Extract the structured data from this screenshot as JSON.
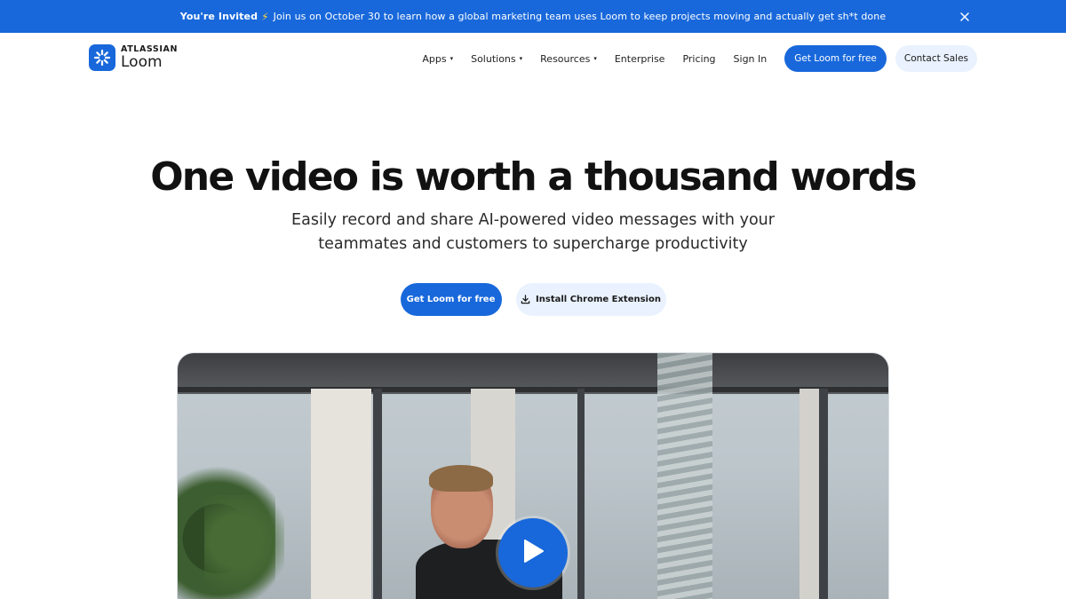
{
  "banner": {
    "lead": "You're Invited",
    "bolt": "⚡",
    "message": "Join us on October 30 to learn how a global marketing team uses Loom to keep projects moving and actually get sh*t done"
  },
  "logo": {
    "company": "ATLASSIAN",
    "product": "Loom"
  },
  "nav": {
    "items": [
      {
        "label": "Apps",
        "dropdown": "▾"
      },
      {
        "label": "Solutions",
        "dropdown": "▾"
      },
      {
        "label": "Resources",
        "dropdown": "▾"
      },
      {
        "label": "Enterprise"
      },
      {
        "label": "Pricing"
      },
      {
        "label": "Sign In"
      }
    ],
    "cta_primary": "Get Loom for free",
    "cta_secondary": "Contact Sales"
  },
  "hero": {
    "title": "One video is worth a thousand words",
    "subtitle": "Easily record and share AI-powered video messages with your teammates and customers to supercharge productivity",
    "cta_primary": "Get Loom for free",
    "cta_secondary": "Install Chrome Extension"
  },
  "colors": {
    "brand_blue": "#1868db",
    "light_blue": "#e9f2fe",
    "text": "#111111"
  }
}
